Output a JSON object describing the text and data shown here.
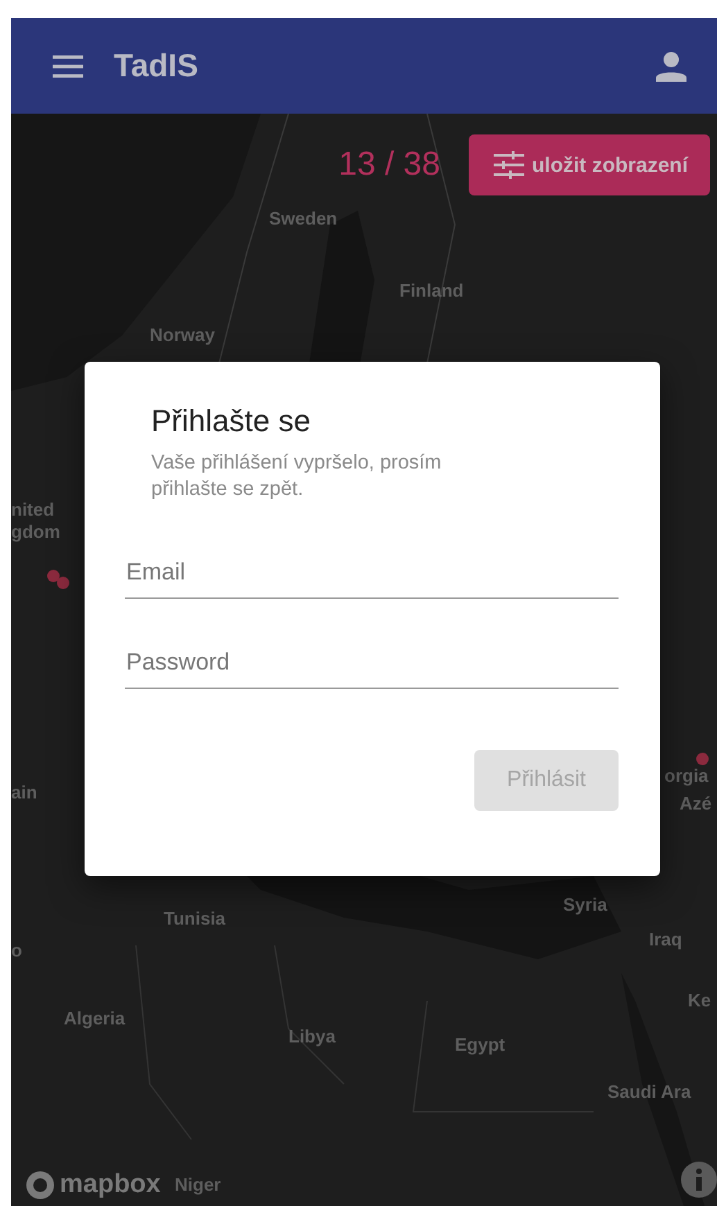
{
  "app_bar": {
    "title": "TadIS"
  },
  "counter": "13 / 38",
  "save_view_button": {
    "label": "uložit zobrazení"
  },
  "map": {
    "labels": [
      {
        "text": "Sweden"
      },
      {
        "text": "Finland"
      },
      {
        "text": "Norway"
      },
      {
        "text": "nited"
      },
      {
        "text": "gdom"
      },
      {
        "text": "ain"
      },
      {
        "text": "orgia"
      },
      {
        "text": "Azé"
      },
      {
        "text": "Tunisia"
      },
      {
        "text": "Syria"
      },
      {
        "text": "o"
      },
      {
        "text": "Iraq"
      },
      {
        "text": "Ke"
      },
      {
        "text": "Algeria"
      },
      {
        "text": "Libya"
      },
      {
        "text": "Egypt"
      },
      {
        "text": "Saudi Ara"
      },
      {
        "text": "Niger"
      }
    ],
    "attribution": "mapbox"
  },
  "dialog": {
    "title": "Přihlašte se",
    "message": "Vaše přihlášení vypršelo, prosím přihlašte se zpět.",
    "fields": [
      {
        "placeholder": "Email"
      },
      {
        "placeholder": "Password"
      }
    ],
    "submit": {
      "label": "Přihlásit",
      "disabled": true
    }
  }
}
